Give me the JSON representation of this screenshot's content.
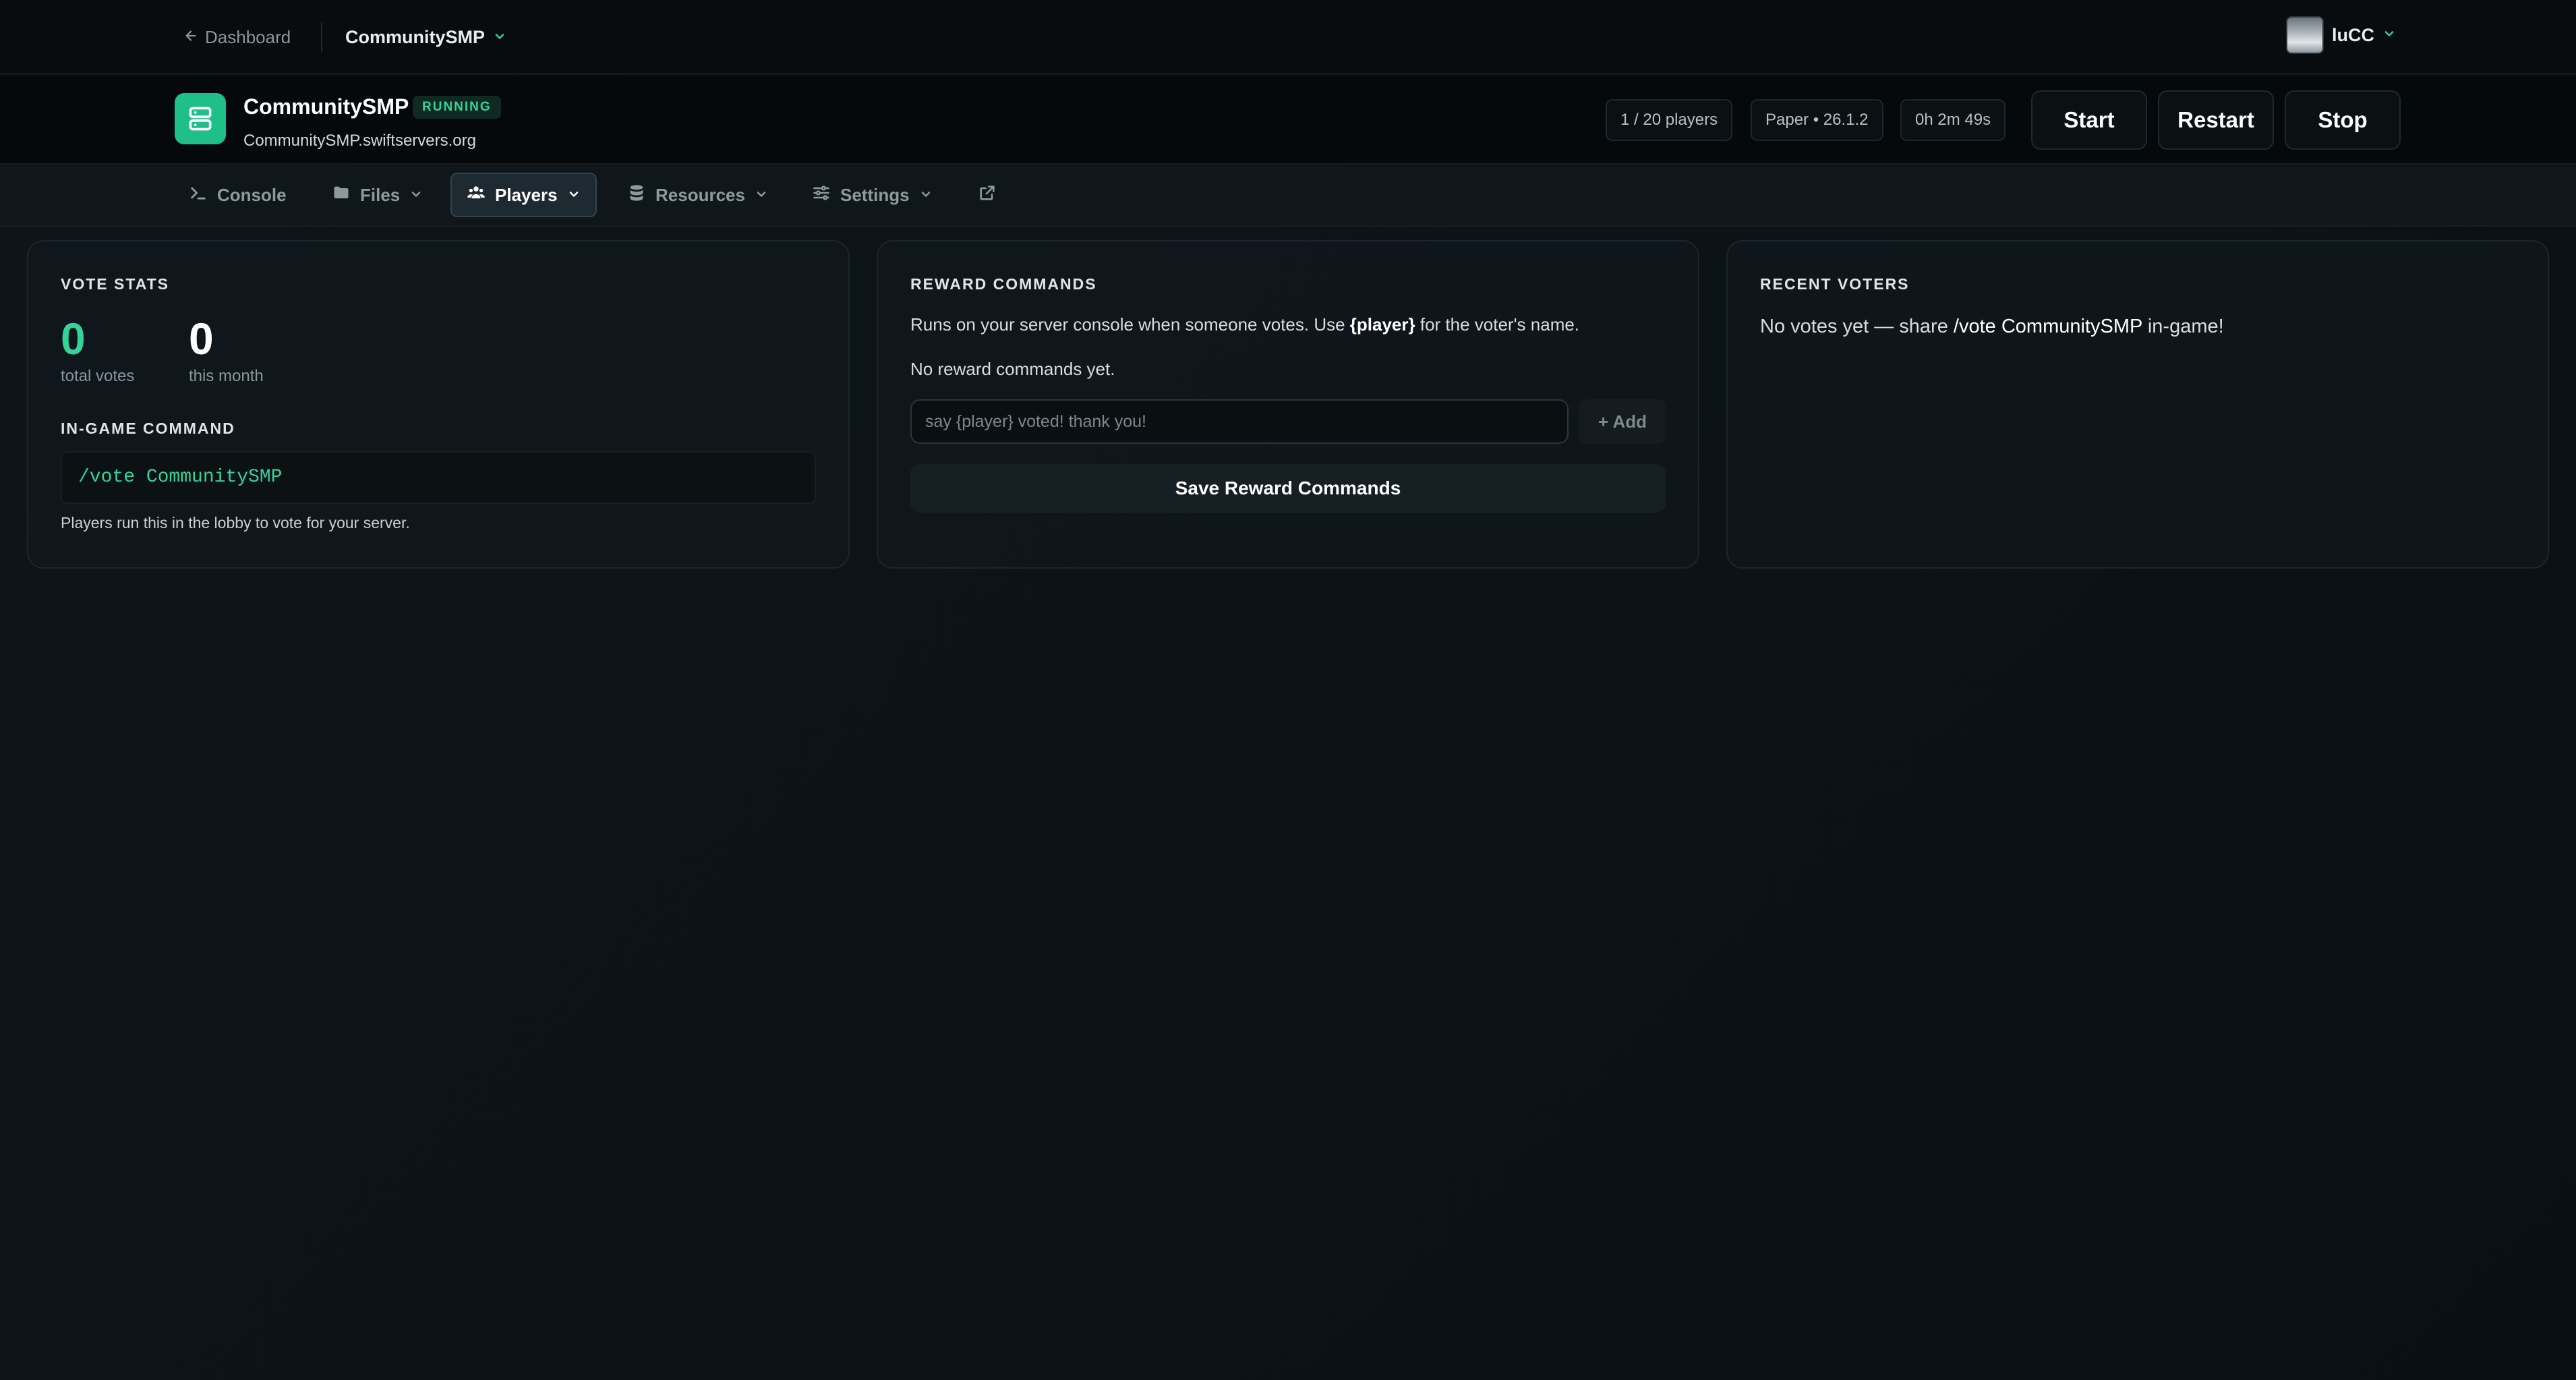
{
  "topbar": {
    "back_label": "Dashboard",
    "server_switch_label": "CommunitySMP",
    "username": "luCC"
  },
  "server": {
    "name": "CommunitySMP",
    "status": "RUNNING",
    "domain": "CommunitySMP.swiftservers.org",
    "players": "1 / 20 players",
    "software": "Paper • 26.1.2",
    "uptime": "0h 2m 49s",
    "actions": {
      "start": "Start",
      "restart": "Restart",
      "stop": "Stop"
    }
  },
  "tabs": [
    {
      "label": "Console",
      "icon": "terminal-icon"
    },
    {
      "label": "Files",
      "icon": "folder-icon"
    },
    {
      "label": "Players",
      "icon": "users-icon",
      "active": true
    },
    {
      "label": "Resources",
      "icon": "database-icon"
    },
    {
      "label": "Settings",
      "icon": "sliders-icon"
    },
    {
      "label": "",
      "icon": "external-link-icon"
    }
  ],
  "vote_stats": {
    "title": "VOTE STATS",
    "total_votes": "0",
    "total_votes_label": "total votes",
    "this_month": "0",
    "this_month_label": "this month",
    "command_title": "IN-GAME COMMAND",
    "command": "/vote CommunitySMP",
    "command_hint": "Players run this in the lobby to vote for your server."
  },
  "reward_commands": {
    "title": "REWARD COMMANDS",
    "desc_before": "Runs on your server console when someone votes. Use ",
    "desc_token": "{player}",
    "desc_after": " for the voter's name.",
    "empty": "No reward commands yet.",
    "input_placeholder": "say {player} voted! thank you!",
    "add_label": "+ Add",
    "save_label": "Save Reward Commands"
  },
  "recent_voters": {
    "title": "RECENT VOTERS",
    "text_before": "No votes yet — share ",
    "text_command": "/vote CommunitySMP",
    "text_after": " in-game!"
  },
  "colors": {
    "accent_green": "#34d399",
    "logo_green": "#1fbf8a",
    "background": "#0c1317"
  }
}
